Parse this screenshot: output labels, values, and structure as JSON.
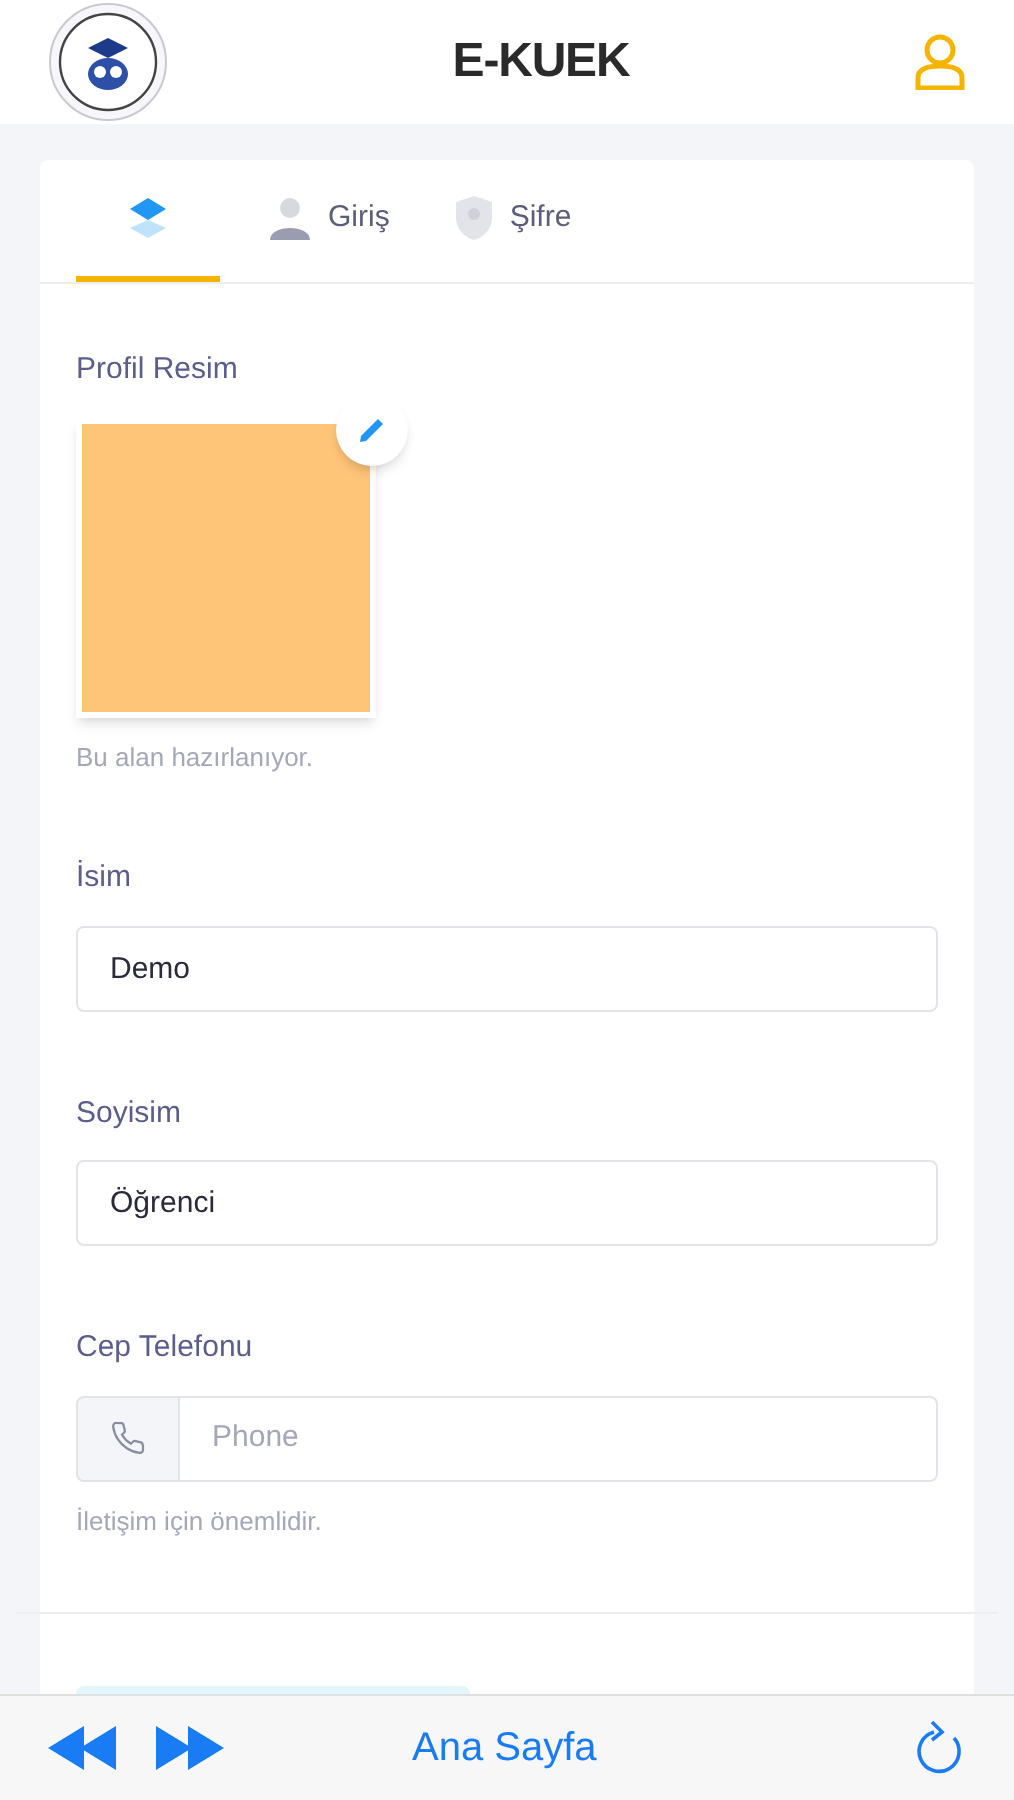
{
  "header": {
    "title": "E-KUEK"
  },
  "tabs": [
    {
      "kind": "layers",
      "selected": true
    },
    {
      "kind": "person",
      "label": "Giriş",
      "selected": false
    },
    {
      "kind": "shield",
      "label": "Şifre",
      "selected": false
    }
  ],
  "profile_picture": {
    "label": "Profil Resim",
    "hint": "Bu alan hazırlanıyor."
  },
  "fields": [
    {
      "kind": "text",
      "label": "İsim",
      "value": "Demo"
    },
    {
      "kind": "text",
      "label": "Soyisim",
      "value": "Öğrenci"
    },
    {
      "kind": "phone",
      "label": "Cep Telefonu",
      "placeholder": "Phone",
      "hint": "İletişim için önemlidir."
    }
  ],
  "bottom_bar": {
    "title": "Ana Sayfa"
  }
}
